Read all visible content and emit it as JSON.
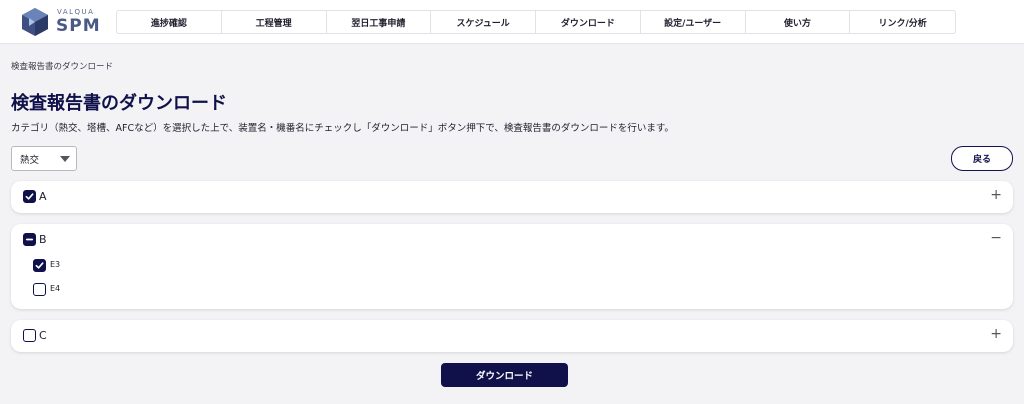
{
  "logo": {
    "small_text": "VALQUA",
    "big_text": "SPM"
  },
  "nav": {
    "items": [
      {
        "label": "進捗確認"
      },
      {
        "label": "工程管理"
      },
      {
        "label": "翌日工事申請"
      },
      {
        "label": "スケジュール"
      },
      {
        "label": "ダウンロード"
      },
      {
        "label": "設定/ユーザー"
      },
      {
        "label": "使い方"
      },
      {
        "label": "リンク/分析"
      }
    ]
  },
  "breadcrumb": "検査報告書のダウンロード",
  "page_title": "検査報告書のダウンロード",
  "description": "カテゴリ（熱交、塔槽、AFCなど）を選択した上で、装置名・機番名にチェックし「ダウンロード」ボタン押下で、検査報告書のダウンロードを行います。",
  "category_select": {
    "selected": "熱交"
  },
  "back_button": "戻る",
  "groups": [
    {
      "label": "A",
      "state": "checked",
      "toggle": "+",
      "items": []
    },
    {
      "label": "B",
      "state": "partial",
      "toggle": "−",
      "items": [
        {
          "label": "E3",
          "checked": true
        },
        {
          "label": "E4",
          "checked": false
        }
      ]
    },
    {
      "label": "C",
      "state": "empty",
      "toggle": "+",
      "items": []
    }
  ],
  "download_button": "ダウンロード",
  "colors": {
    "primary": "#10114a",
    "background": "#f3f3f5",
    "logo": "#4a5a86"
  }
}
